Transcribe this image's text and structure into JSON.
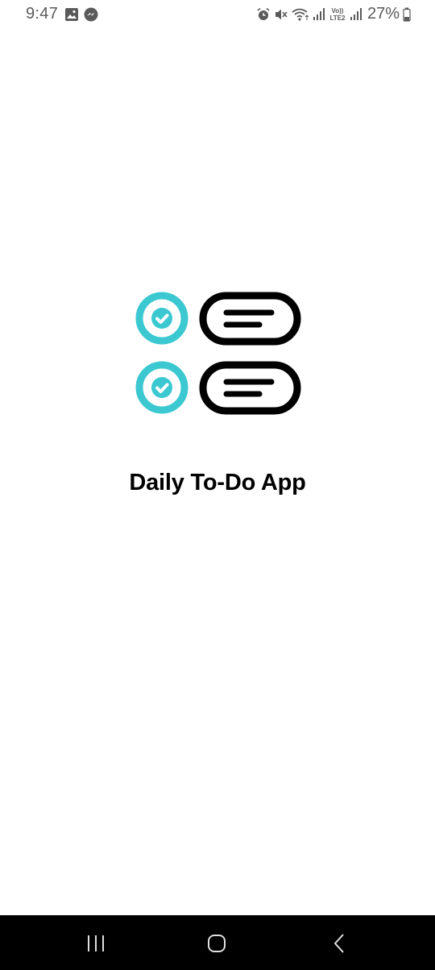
{
  "status_bar": {
    "time": "9:47",
    "left_icons": [
      "gallery-icon",
      "messenger-icon"
    ],
    "right_icons": [
      "alarm-icon",
      "mute-icon",
      "wifi-icon",
      "signal-icon",
      "volte-icon",
      "signal-icon"
    ],
    "volte_label": "Vo))",
    "lte_label": "LTE2",
    "battery_text": "27%"
  },
  "splash": {
    "logo_icon": "checklist-icon",
    "accent_color": "#3cc8d0",
    "title": "Daily To-Do App"
  },
  "nav_bar": {
    "buttons": [
      "recents-icon",
      "home-icon",
      "back-icon"
    ]
  }
}
